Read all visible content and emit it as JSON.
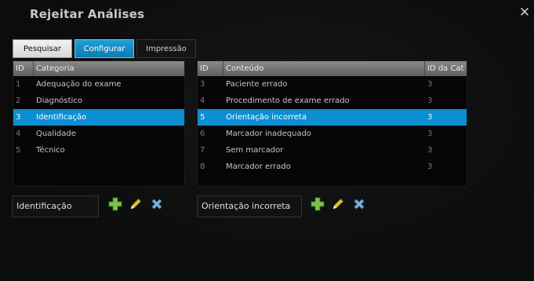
{
  "window": {
    "title": "Rejeitar Análises",
    "close_glyph": "✕"
  },
  "tabs": [
    {
      "label": "Pesquisar",
      "state": "normal"
    },
    {
      "label": "Configurar",
      "state": "active"
    },
    {
      "label": "Impressão",
      "state": "dark"
    }
  ],
  "categories": {
    "headers": [
      "ID",
      "Categoria"
    ],
    "rows": [
      {
        "id": "1",
        "name": "Adequação do exame"
      },
      {
        "id": "2",
        "name": "Diagnóstico"
      },
      {
        "id": "3",
        "name": "Identificação",
        "selected": true
      },
      {
        "id": "4",
        "name": "Qualidade"
      },
      {
        "id": "5",
        "name": "Técnico"
      }
    ],
    "edit_value": "Identificação"
  },
  "contents": {
    "headers": [
      "ID",
      "Conteúdo",
      "ID da Cat"
    ],
    "rows": [
      {
        "id": "3",
        "name": "Paciente errado",
        "cat": "3"
      },
      {
        "id": "4",
        "name": "Procedimento de exame errado",
        "cat": "3"
      },
      {
        "id": "5",
        "name": "Orientação incorreta",
        "cat": "3",
        "selected": true
      },
      {
        "id": "6",
        "name": "Marcador inadequado",
        "cat": "3"
      },
      {
        "id": "7",
        "name": "Sem marcador",
        "cat": "3"
      },
      {
        "id": "8",
        "name": "Marcador errado",
        "cat": "3"
      }
    ],
    "edit_value": "Orientação incorreta"
  },
  "icons": {
    "add": "plus-icon",
    "edit": "pencil-icon",
    "delete": "x-mark-icon"
  },
  "colors": {
    "accent": "#0c8ed3",
    "add_green": "#7bc34a",
    "edit_yellow": "#e3c22e",
    "delete_blue": "#7fb4d8"
  }
}
